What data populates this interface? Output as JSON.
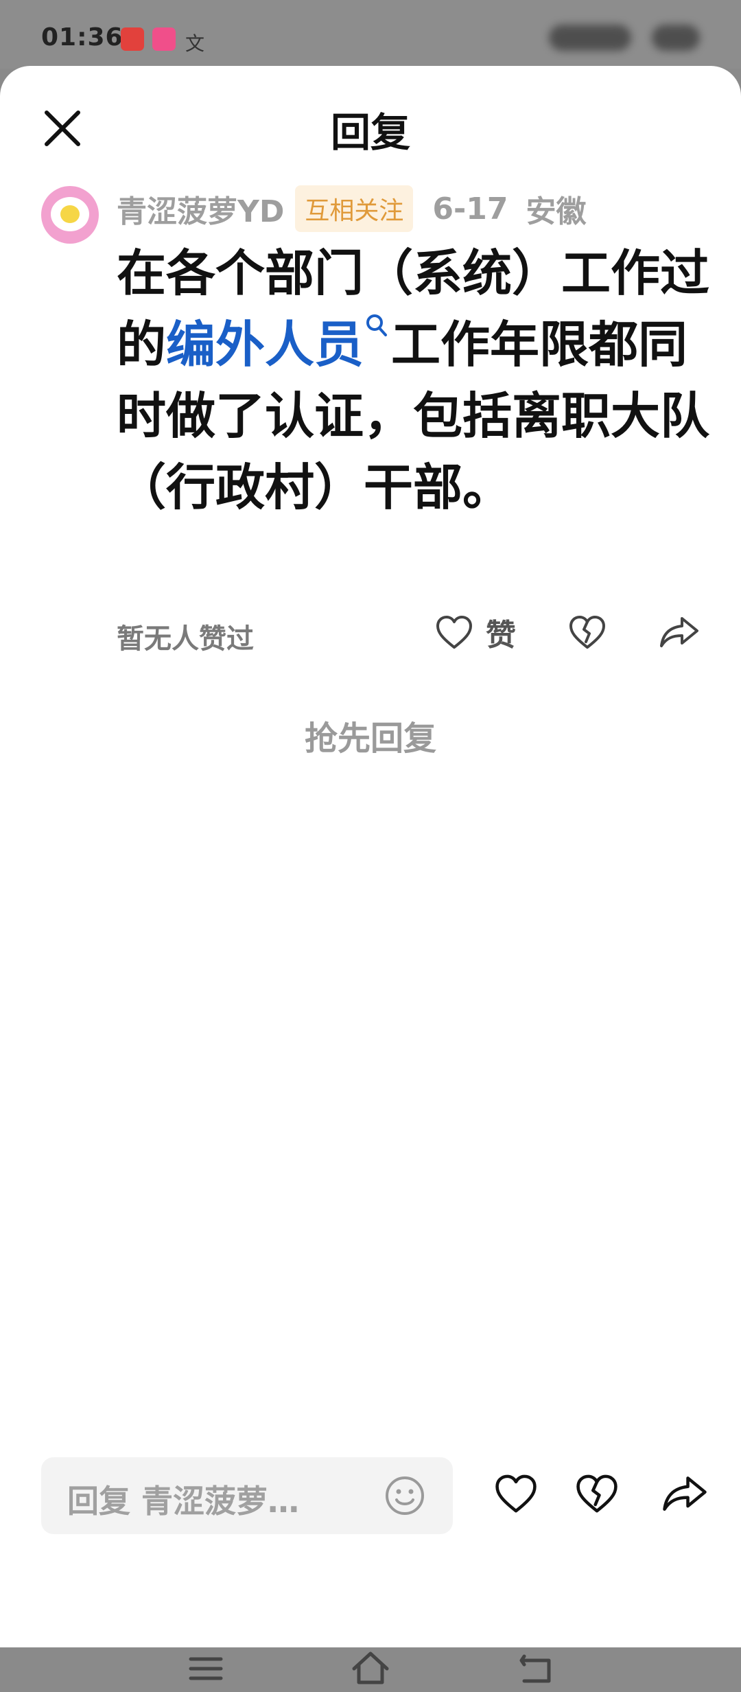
{
  "status_bar": {
    "time": "01:36",
    "app_icon3": "文"
  },
  "header": {
    "title": "回复",
    "close_icon": "close-icon"
  },
  "comment": {
    "username": "青涩菠萝YD",
    "badge": "互相关注",
    "date": "6-17",
    "location": "安徽",
    "text_before_link": "在各个部门（系统）工作过的",
    "link_text": "编外人员",
    "text_after_link": "工作年限都同时做了认证，包括离职大队（行政村）干部。",
    "no_likes_text": "暂无人赞过",
    "like_label": "赞"
  },
  "empty_state": {
    "text": "抢先回复"
  },
  "reply_bar": {
    "placeholder": "回复 青涩菠萝…"
  },
  "colors": {
    "link": "#1a5fc7",
    "badge_bg": "#fdf1df",
    "badge_text": "#e09a3a"
  }
}
